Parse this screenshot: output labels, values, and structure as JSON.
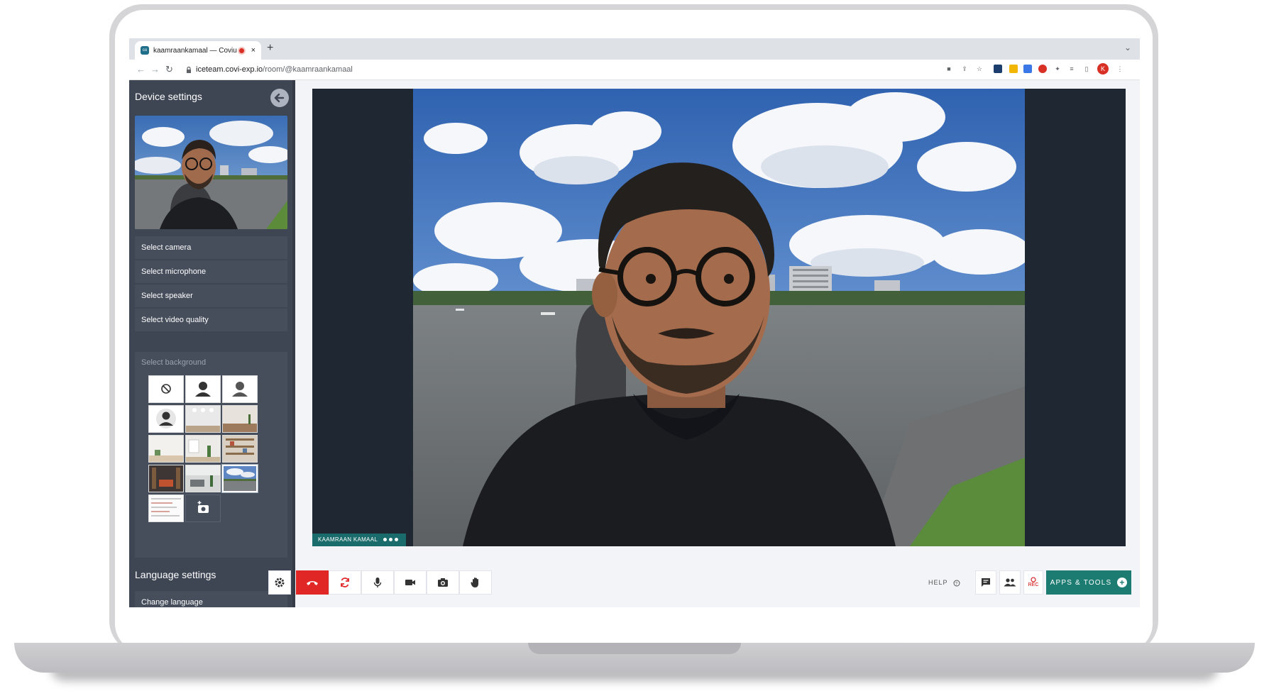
{
  "browser": {
    "tab_title": "kaamraankamaal — Coviu",
    "tab_close": "×",
    "favicon_text": "co",
    "new_tab": "+",
    "url_host": "iceteam.covi-exp.io",
    "url_path": "/room/@kaamraankamaal",
    "profile_initial": "K"
  },
  "sidebar": {
    "title": "Device settings",
    "items": [
      {
        "label": "Select camera"
      },
      {
        "label": "Select microphone"
      },
      {
        "label": "Select speaker"
      },
      {
        "label": "Select video quality"
      }
    ],
    "background_label": "Select background",
    "language_title": "Language settings",
    "language_item": "Change language"
  },
  "stage": {
    "participant_name": "KAAMRAAN KAMAAL"
  },
  "toolbar": {
    "help_label": "HELP",
    "rec_label": "REC",
    "apps_label": "APPS & TOOLS",
    "apps_plus": "+"
  },
  "colors": {
    "sidebar": "#3e4553",
    "accent": "#1d7c72",
    "hangup": "#e12726"
  }
}
